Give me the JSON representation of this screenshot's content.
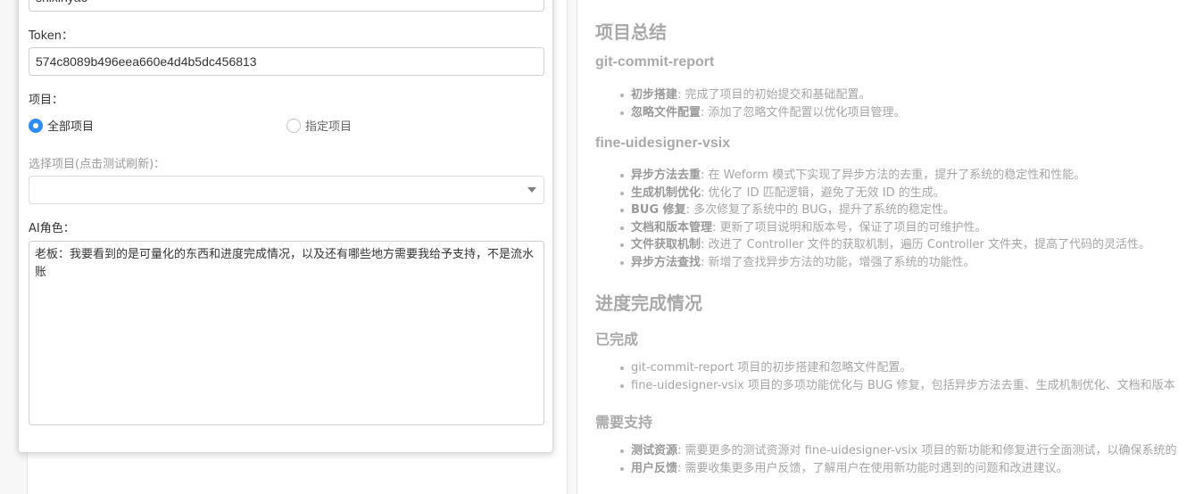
{
  "form": {
    "top_input_value": "shixinyao",
    "token_label": "Token：",
    "token_value": "574c8089b496eea660e4d4b5dc456813",
    "project_label": "项目：",
    "radio_all": "全部项目",
    "radio_specific": "指定项目",
    "select_label": "选择项目(点击测试刷新)：",
    "select_value": "",
    "role_label": "AI角色：",
    "role_value": "老板：我要看到的是可量化的东西和进度完成情况，以及还有哪些地方需要我给予支持，不是流水账"
  },
  "preview": {
    "summary_title": "项目总结",
    "projects": [
      {
        "name": "git-commit-report",
        "items": [
          {
            "key": "初步搭建",
            "text": ": 完成了项目的初始提交和基础配置。"
          },
          {
            "key": "忽略文件配置",
            "text": ": 添加了忽略文件配置以优化项目管理。"
          }
        ]
      },
      {
        "name": "fine-uidesigner-vsix",
        "items": [
          {
            "key": "异步方法去重",
            "text": ": 在 Weform 模式下实现了异步方法的去重，提升了系统的稳定性和性能。"
          },
          {
            "key": "生成机制优化",
            "text": ": 优化了 ID 匹配逻辑，避免了无效 ID 的生成。"
          },
          {
            "key": "BUG 修复",
            "text": ": 多次修复了系统中的 BUG，提升了系统的稳定性。"
          },
          {
            "key": "文档和版本管理",
            "text": ": 更新了项目说明和版本号，保证了项目的可维护性。"
          },
          {
            "key": "文件获取机制",
            "text": ": 改进了 Controller 文件的获取机制，遍历 Controller 文件夹，提高了代码的灵活性。"
          },
          {
            "key": "异步方法查找",
            "text": ": 新增了查找异步方法的功能，增强了系统的功能性。"
          }
        ]
      }
    ],
    "progress_title": "进度完成情况",
    "done_title": "已完成",
    "done_items": [
      "git-commit-report 项目的初步搭建和忽略文件配置。",
      "fine-uidesigner-vsix 项目的多项功能优化与 BUG 修复，包括异步方法去重、生成机制优化、文档和版本"
    ],
    "support_title": "需要支持",
    "support_items": [
      {
        "key": "测试资源",
        "text": ": 需要更多的测试资源对 fine-uidesigner-vsix 项目的新功能和修复进行全面测试，以确保系统的"
      },
      {
        "key": "用户反馈",
        "text": ": 需要收集更多用户反馈，了解用户在使用新功能时遇到的问题和改进建议。"
      }
    ]
  },
  "colors": {
    "accent": "#2d8cf0",
    "preview_text": "#a7a7a7"
  }
}
